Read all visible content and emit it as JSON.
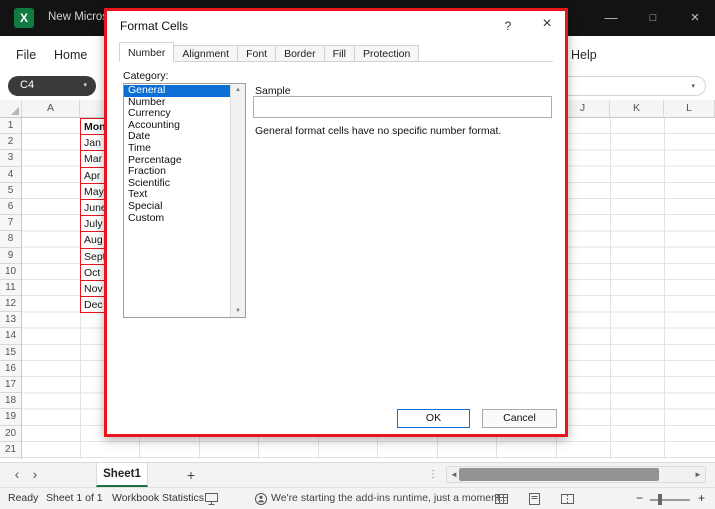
{
  "colors": {
    "excel_green": "#107c41",
    "annotation_red": "#e8151d",
    "selection_blue": "#0b6fd4",
    "titlebar_bg": "#131313"
  },
  "titlebar": {
    "app_title": "New Microso",
    "minimize_glyph": "—",
    "maximize_glyph": "□",
    "close_glyph": "×",
    "excel_icon_glyph": "X"
  },
  "ribbon": {
    "file_tab": "File",
    "home_tab": "Home",
    "help_tab": "Help"
  },
  "formula": {
    "name_box_value": "C4"
  },
  "grid": {
    "row_count": 21,
    "left_column_header": "A",
    "right_column_headers": [
      "J",
      "K",
      "L"
    ],
    "column_b_cells": [
      {
        "row": 1,
        "text": "Mon",
        "bold": true
      },
      {
        "row": 2,
        "text": "Jan"
      },
      {
        "row": 3,
        "text": "Mar"
      },
      {
        "row": 4,
        "text": "Apr"
      },
      {
        "row": 5,
        "text": "May"
      },
      {
        "row": 6,
        "text": "June"
      },
      {
        "row": 7,
        "text": "July"
      },
      {
        "row": 8,
        "text": "Aug"
      },
      {
        "row": 9,
        "text": "Sept"
      },
      {
        "row": 10,
        "text": "Oct"
      },
      {
        "row": 11,
        "text": "Nov"
      },
      {
        "row": 12,
        "text": "Dec"
      }
    ]
  },
  "dialog": {
    "title": "Format Cells",
    "help_glyph": "?",
    "close_glyph": "×",
    "tabs": [
      "Number",
      "Alignment",
      "Font",
      "Border",
      "Fill",
      "Protection"
    ],
    "selected_tab": "Number",
    "category_label": "Category:",
    "categories": [
      "General",
      "Number",
      "Currency",
      "Accounting",
      "Date",
      "Time",
      "Percentage",
      "Fraction",
      "Scientific",
      "Text",
      "Special",
      "Custom"
    ],
    "selected_category": "General",
    "sample_label": "Sample",
    "sample_value": "",
    "description": "General format cells have no specific number format.",
    "ok_label": "OK",
    "cancel_label": "Cancel"
  },
  "sheet_bar": {
    "active_sheet": "Sheet1",
    "add_sheet_glyph": "+",
    "prev_glyph": "‹",
    "next_glyph": "›"
  },
  "status_bar": {
    "ready": "Ready",
    "sheet_count": "Sheet 1 of 1",
    "workbook_statistics": "Workbook Statistics",
    "addins_message": "We're starting the add-ins runtime, just a moment...",
    "zoom_minus": "−",
    "zoom_plus": "+"
  },
  "icons": {
    "name_box_chevron": "▾",
    "formula_chevron": "▾",
    "share_chevron": "▾",
    "overflow_dots": "⋮",
    "tab_overflow_dots": "⋮",
    "scroll_left": "◄",
    "scroll_right": "►",
    "list_scroll_up": "▲",
    "list_scroll_down": "▼"
  }
}
